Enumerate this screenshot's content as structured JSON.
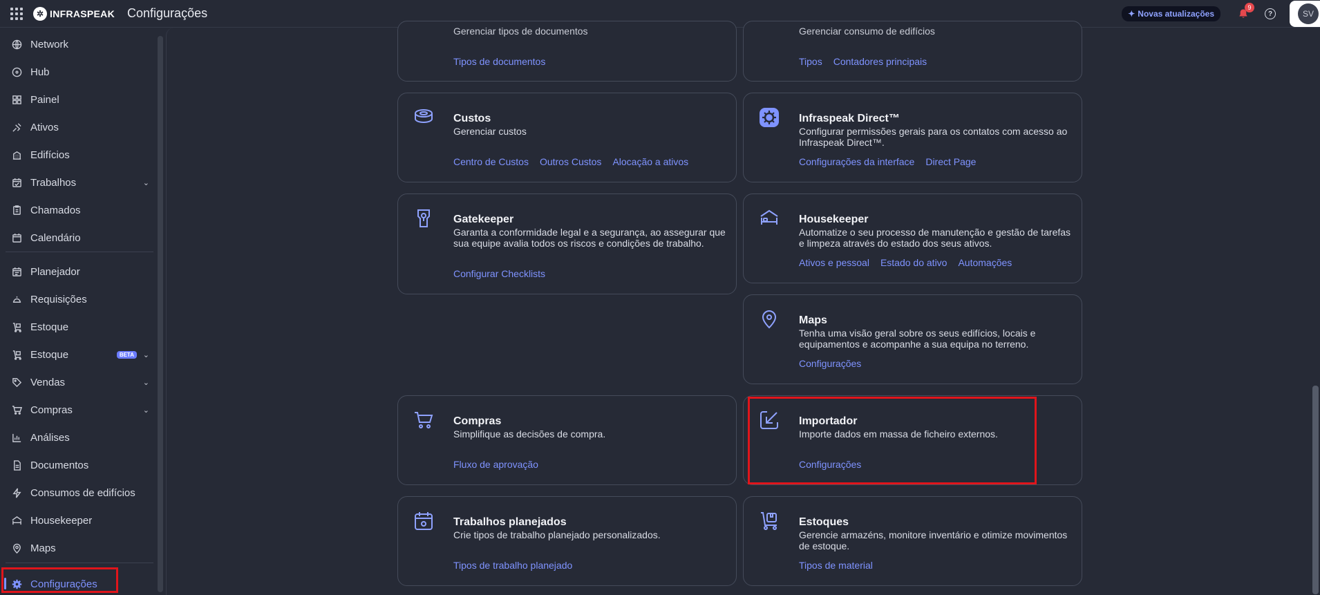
{
  "header": {
    "logo_mark": "✲",
    "logo_text": "INFRASPEAK",
    "page_title": "Configurações",
    "updates_label": "Novas atualizações",
    "notifications_count": "9",
    "help_label": "?",
    "avatar_initials": "SV"
  },
  "sidebar": {
    "items": [
      {
        "label": "Network",
        "icon": "network-icon"
      },
      {
        "label": "Hub",
        "icon": "hub-icon"
      },
      {
        "label": "Painel",
        "icon": "dashboard-icon"
      },
      {
        "label": "Ativos",
        "icon": "assets-icon"
      },
      {
        "label": "Edifícios",
        "icon": "buildings-icon"
      },
      {
        "label": "Trabalhos",
        "icon": "jobs-icon",
        "chevron": "⌄"
      },
      {
        "label": "Chamados",
        "icon": "tickets-icon"
      },
      {
        "label": "Calendário",
        "icon": "calendar-icon"
      },
      {
        "label": "Planejador",
        "icon": "planner-icon"
      },
      {
        "label": "Requisições",
        "icon": "requests-icon"
      },
      {
        "label": "Estoque",
        "icon": "stock-icon"
      },
      {
        "label": "Estoque",
        "icon": "stock-beta-icon",
        "chevron": "⌄",
        "badge": "BETA"
      },
      {
        "label": "Vendas",
        "icon": "sales-icon",
        "chevron": "⌄"
      },
      {
        "label": "Compras",
        "icon": "cart-icon",
        "chevron": "⌄"
      },
      {
        "label": "Análises",
        "icon": "analytics-icon"
      },
      {
        "label": "Documentos",
        "icon": "documents-icon"
      },
      {
        "label": "Consumos de edifícios",
        "icon": "bolt-icon"
      },
      {
        "label": "Housekeeper",
        "icon": "housekeeper-icon"
      },
      {
        "label": "Maps",
        "icon": "map-pin-icon"
      },
      {
        "label": "Configurações",
        "icon": "gear-icon",
        "active": true
      }
    ]
  },
  "cards": {
    "documents_partial": {
      "desc": "Gerenciar tipos de documentos",
      "links": [
        "Tipos de documentos"
      ]
    },
    "consumption_partial": {
      "desc": "Gerenciar consumo de edifícios",
      "links": [
        "Tipos",
        "Contadores principais"
      ]
    },
    "costs": {
      "title": "Custos",
      "desc": "Gerenciar custos",
      "links": [
        "Centro de Custos",
        "Outros Custos",
        "Alocação a ativos"
      ]
    },
    "direct": {
      "title": "Infraspeak Direct™",
      "desc": "Configurar permissões gerais para os contatos com acesso ao Infraspeak Direct™.",
      "links": [
        "Configurações da interface",
        "Direct Page"
      ]
    },
    "gatekeeper": {
      "title": "Gatekeeper",
      "desc": "Garanta a conformidade legal e a segurança, ao assegurar que sua equipe avalia todos os riscos e condições de trabalho.",
      "links": [
        "Configurar Checklists"
      ]
    },
    "housekeeper": {
      "title": "Housekeeper",
      "desc": "Automatize o seu processo de manutenção e gestão de tarefas e limpeza através do estado dos seus ativos.",
      "links": [
        "Ativos e pessoal",
        "Estado do ativo",
        "Automações"
      ]
    },
    "maps": {
      "title": "Maps",
      "desc": "Tenha uma visão geral sobre os seus edifícios, locais e equipamentos e acompanhe a sua equipa no terreno.",
      "links": [
        "Configurações"
      ]
    },
    "purchases": {
      "title": "Compras",
      "desc": "Simplifique as decisões de compra.",
      "links": [
        "Fluxo de aprovação"
      ]
    },
    "importer": {
      "title": "Importador",
      "desc": "Importe dados em massa de ficheiro externos.",
      "links": [
        "Configurações"
      ]
    },
    "planned_jobs": {
      "title": "Trabalhos planejados",
      "desc": "Crie tipos de trabalho planejado personalizados.",
      "links": [
        "Tipos de trabalho planejado"
      ]
    },
    "stocks": {
      "title": "Estoques",
      "desc": "Gerencie armazéns, monitore inventário e otimize movimentos de estoque.",
      "links": [
        "Tipos de material"
      ]
    }
  },
  "colors": {
    "accent": "#7f93ff",
    "background": "#262a36",
    "highlight": "#e0151b"
  }
}
